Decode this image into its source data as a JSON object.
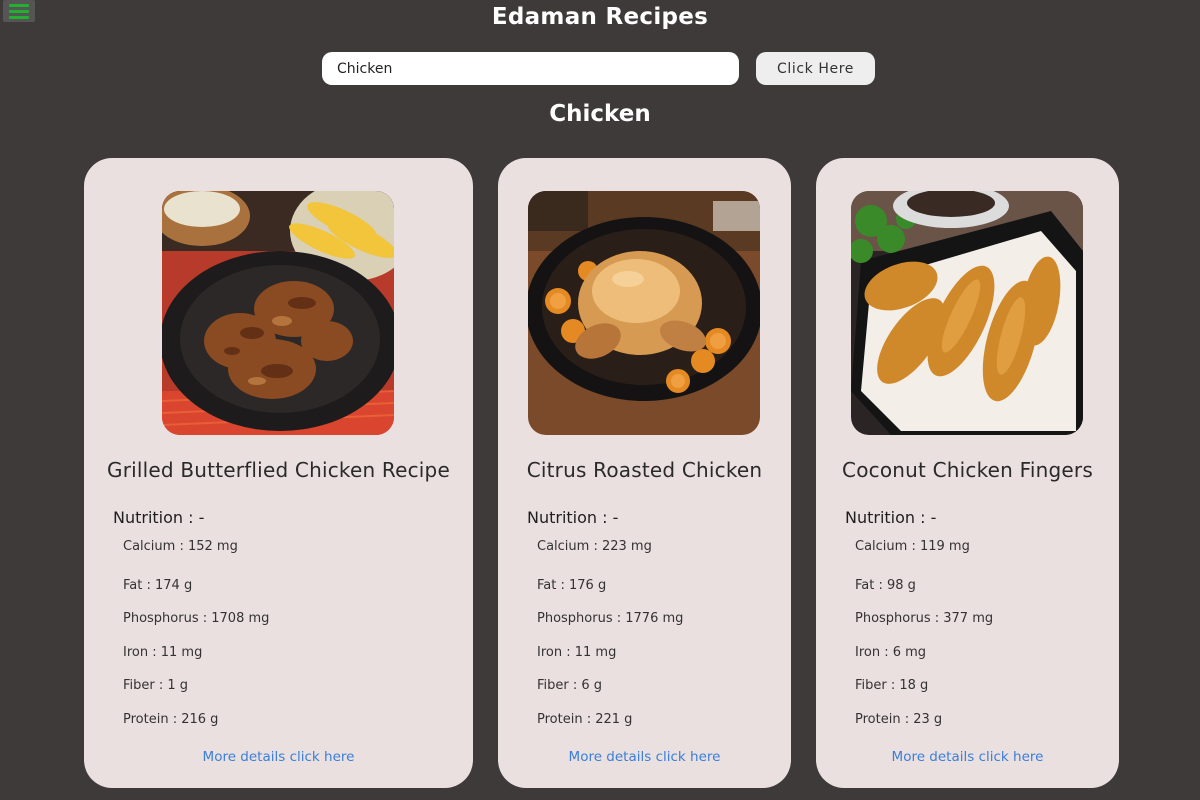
{
  "header": {
    "title": "Edaman Recipes",
    "menu_icon": "hamburger-menu-icon"
  },
  "search": {
    "value": "Chicken",
    "button_label": "Click Here"
  },
  "results": {
    "heading": "Chicken"
  },
  "recipes": [
    {
      "title": "Grilled Butterflied Chicken Recipe",
      "nutrition_heading": "Nutrition : -",
      "calcium": "Calcium : 152 mg",
      "fat": "Fat : 174 g",
      "phosphorus": "Phosphorus : 1708 mg",
      "iron": "Iron : 11 mg",
      "fiber": "Fiber : 1 g",
      "protein": "Protein : 216 g",
      "link": "More details click here"
    },
    {
      "title": "Citrus Roasted Chicken",
      "nutrition_heading": "Nutrition : -",
      "calcium": "Calcium : 223 mg",
      "fat": "Fat : 176 g",
      "phosphorus": "Phosphorus : 1776 mg",
      "iron": "Iron : 11 mg",
      "fiber": "Fiber : 6 g",
      "protein": "Protein : 221 g",
      "link": "More details click here"
    },
    {
      "title": "Coconut Chicken Fingers",
      "nutrition_heading": "Nutrition : -",
      "calcium": "Calcium : 119 mg",
      "fat": "Fat : 98 g",
      "phosphorus": "Phosphorus : 377 mg",
      "iron": "Iron : 6 mg",
      "fiber": "Fiber : 18 g",
      "protein": "Protein : 23 g",
      "link": "More details click here"
    }
  ],
  "colors": {
    "background": "#3e3a3a",
    "card": "#ebe0e0",
    "link": "#3a7fd8",
    "menu_accent": "#22b12c"
  }
}
